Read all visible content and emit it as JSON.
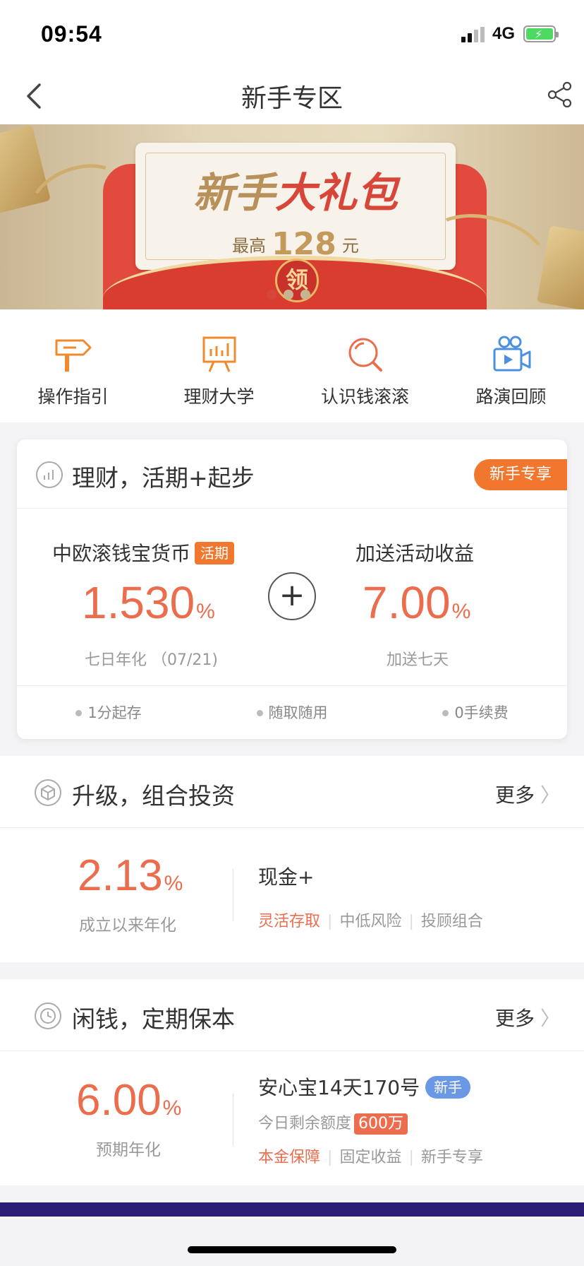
{
  "status_bar": {
    "time": "09:54",
    "network": "4G"
  },
  "nav": {
    "title": "新手专区"
  },
  "banner": {
    "headline_a": "新手",
    "headline_b": "大礼包",
    "sub_prefix": "最高",
    "sub_amount": "128",
    "sub_unit": "元",
    "seal": "领",
    "slide_count": 3,
    "active_slide": 1
  },
  "quick_menu": [
    {
      "label": "操作指引",
      "icon": "signpost-icon"
    },
    {
      "label": "理财大学",
      "icon": "presentation-board-icon"
    },
    {
      "label": "认识钱滚滚",
      "icon": "magnifier-icon"
    },
    {
      "label": "路演回顾",
      "icon": "video-camera-icon"
    }
  ],
  "section_current": {
    "title": "理财，活期+起步",
    "tag": "新手专享",
    "product_name": "中欧滚钱宝货币",
    "product_badge": "活期",
    "rate": "1.530",
    "rate_unit": "%",
    "rate_note": "七日年化 （07/21)",
    "bonus_title": "加送活动收益",
    "bonus_rate": "7.00",
    "bonus_unit": "%",
    "bonus_note": "加送七天",
    "plus": "+",
    "features": [
      "1分起存",
      "随取随用",
      "0手续费"
    ]
  },
  "section_portfolio": {
    "title": "升级，组合投资",
    "more": "更多",
    "rate": "2.13",
    "rate_unit": "%",
    "rate_note": "成立以来年化",
    "product_name": "现金+",
    "tags": [
      "灵活存取",
      "中低风险",
      "投顾组合"
    ]
  },
  "section_fixed": {
    "title": "闲钱，定期保本",
    "more": "更多",
    "rate": "6.00",
    "rate_unit": "%",
    "rate_note": "预期年化",
    "product_name": "安心宝14天170号",
    "product_badge": "新手",
    "quota_label": "今日剩余额度",
    "quota_amount": "600万",
    "tags": [
      "本金保障",
      "固定收益",
      "新手专享"
    ]
  },
  "colors": {
    "accent": "#f0772d",
    "rate": "#ec6c4e",
    "badge_blue": "#6a98e4",
    "banner_red": "#e24a3d"
  }
}
